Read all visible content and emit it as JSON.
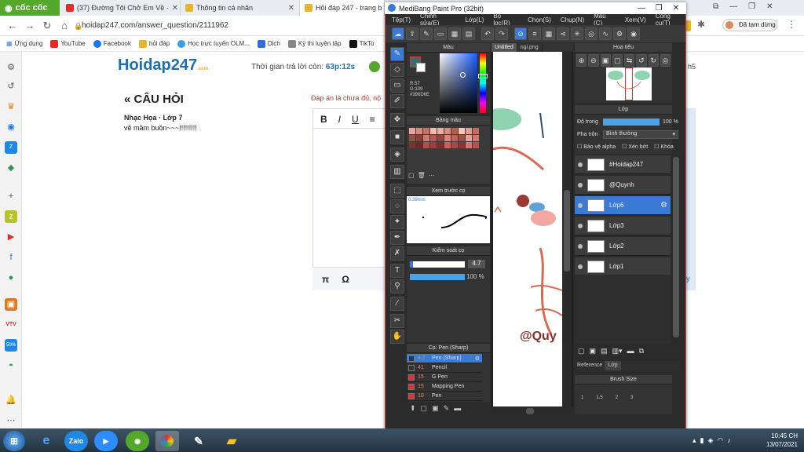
{
  "browser": {
    "brand": "cốc cốc",
    "tabs": [
      {
        "label": "(37) Đường Tôi Chở Em Về ·",
        "color": "#e52d27"
      },
      {
        "label": "Thông tin cá nhân",
        "color": "#e7b52c"
      },
      {
        "label": "Hỏi đáp 247 - trang b",
        "color": "#e7b52c"
      }
    ],
    "url": "hoidap247.com/answer_question/2111962",
    "bookmarks": [
      "Ứng dụng",
      "YouTube",
      "Facebook",
      "hỏi đáp",
      "Học trực tuyến OLM...",
      "Dịch",
      "Kỳ thi luyện tập",
      "TikTo"
    ],
    "profile": "Đã tạm dừng"
  },
  "page": {
    "logo": "Hoidap247",
    "logo_sub": ".com",
    "timer_label": "Thời gian trả lời còn:",
    "timer_value": "63p:12s",
    "section_title": "« CÂU HỎI",
    "subject": "Nhạc Họa · Lớp 7",
    "question": "vẽ mầm buồn~~~!!!!!!!!!",
    "answer_note": "Đáp án là chưa đủ, nộ",
    "editor_buttons": [
      "B",
      "I",
      "U"
    ],
    "editor_bottom": [
      "π",
      "Ω"
    ],
    "side_text": "h5",
    "side_text2": "y"
  },
  "medibang": {
    "title": "MediBang Paint Pro (32bit)",
    "menu": [
      "Tệp(T)",
      "Chỉnh sửa(E)",
      "Lớp(L)",
      "Bộ lọc(R)",
      "Chọn(S)",
      "Chụp(N)",
      "Màu (C)",
      "Xem(V)",
      "Công cụ(T)"
    ],
    "panels": {
      "color": "Màu",
      "palette": "Bảng màu",
      "brush_preview": "Xem trước cọ",
      "brush_size_value": "0.39mm",
      "brush_control": "Kiểm soát cọ",
      "size_value": "4.7",
      "opacity_value": "100 %",
      "brush_list": "Cọ: Pen (Sharp)",
      "navigator": "Hoa tiêu",
      "layers": "Lớp",
      "opacity_label": "Độ trong",
      "opacity_pct": "100 %",
      "blend_label": "Pha trộn",
      "blend_value": "Bình thường",
      "protect_alpha": "Bảo vệ alpha",
      "clipping": "Xén bớt",
      "lock": "Khóa",
      "reference": "Reference",
      "layer_tab": "Lớp",
      "brush_size_panel": "Brush Size"
    },
    "rgb": [
      "R:57",
      "G:109",
      "#396D6E"
    ],
    "canvas_tabs": [
      "Untitled",
      "ngi.png"
    ],
    "canvas_watermark": "@Quy",
    "layers": [
      {
        "name": "#Hoidap247",
        "selected": false
      },
      {
        "name": "@Quynh",
        "selected": false
      },
      {
        "name": "Lớp6",
        "selected": true
      },
      {
        "name": "Lớp3",
        "selected": false
      },
      {
        "name": "Lớp2",
        "selected": false
      },
      {
        "name": "Lớp1",
        "selected": false
      }
    ],
    "brushes": [
      {
        "size": "4.7",
        "name": "Pen (Sharp)",
        "color": "#1b3a5a",
        "selected": true
      },
      {
        "size": "41",
        "name": "Pencil",
        "color": "#333333",
        "selected": false
      },
      {
        "size": "15",
        "name": "G Pen",
        "color": "#e03030",
        "selected": false
      },
      {
        "size": "15",
        "name": "Mapping Pen",
        "color": "#e03030",
        "selected": false
      },
      {
        "size": "10",
        "name": "Pen",
        "color": "#e03030",
        "selected": false
      }
    ],
    "brush_size_ticks": [
      "1",
      "1.5",
      "2",
      "3"
    ]
  },
  "taskbar": {
    "apps": [
      "Zalo",
      "Zoom"
    ],
    "time": "10:45 CH",
    "date": "13/07/2021"
  }
}
